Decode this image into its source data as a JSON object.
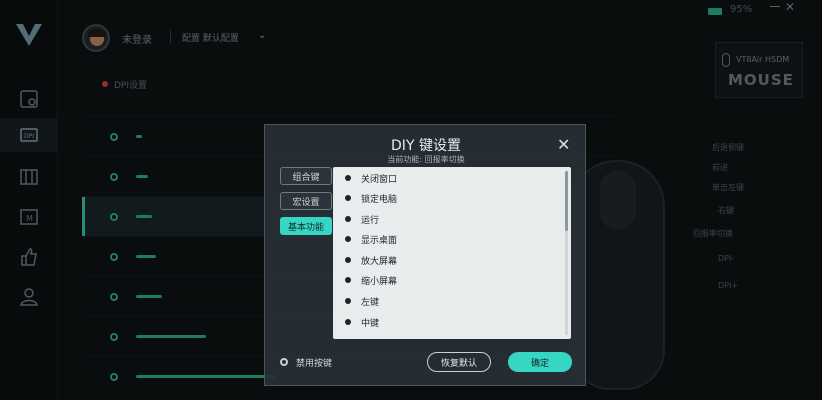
{
  "header": {
    "user_name": "未登录",
    "config_label": "配置  默认配置",
    "battery_text": "95%",
    "close_glyph": "✕",
    "chevron": "⌄"
  },
  "section": {
    "title": "DPI设置"
  },
  "device": {
    "model": "VT8Air HSDM",
    "brand": "MOUSE",
    "callouts": [
      "后退侧键",
      "前进",
      "单击左键",
      "右键",
      "回报率切换",
      "DPI-",
      "DPI+"
    ]
  },
  "modal": {
    "title": "DIY 键设置",
    "subtitle": "当前功能: 回报率切换",
    "close": "✕",
    "side_buttons": [
      "组合键",
      "宏设置",
      "基本功能"
    ],
    "functions": [
      "关闭窗口",
      "锁定电脑",
      "运行",
      "显示桌面",
      "放大屏幕",
      "缩小屏幕",
      "左键",
      "中键"
    ],
    "disable_label": "禁用按键",
    "restore_label": "恢复默认",
    "ok_label": "确定"
  },
  "colors": {
    "accent": "#37d6c4",
    "background": "#101416",
    "record_dot": "#e04848"
  }
}
